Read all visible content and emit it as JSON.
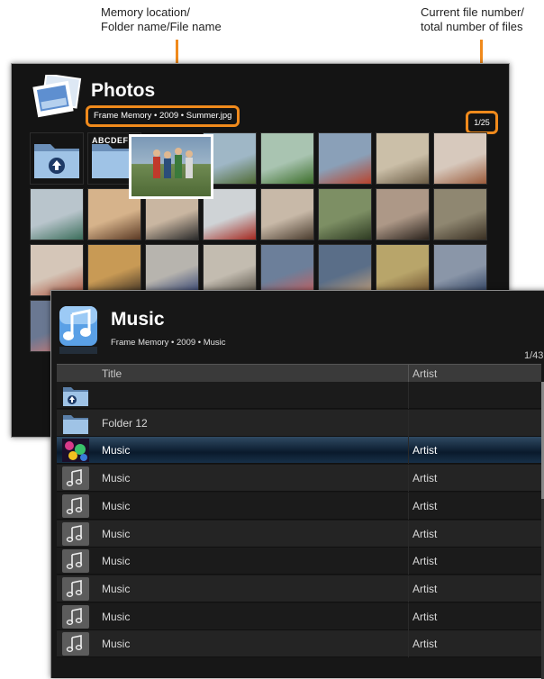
{
  "callouts": {
    "location": {
      "line1": "Memory location/",
      "line2": "Folder name/File name"
    },
    "count": {
      "line1": "Current file number/",
      "line2": "total number of files"
    }
  },
  "photos": {
    "title": "Photos",
    "path": "Frame Memory • 2009 • Summer.jpg",
    "count": "1/25",
    "folder_label": "ABCDEF",
    "thumbs": [
      {
        "color": "#9fb7c6",
        "accent": "#4f6a33"
      },
      {
        "color": "#a9c4b1",
        "accent": "#3c6e2a"
      },
      {
        "color": "#8aa0b8",
        "accent": "#b8432c"
      },
      {
        "color": "#cbbfa8",
        "accent": "#6a5b44"
      },
      {
        "color": "#d7c9bd",
        "accent": "#9b5b3b"
      },
      {
        "color": "#b9c5cc",
        "accent": "#3b6e5b"
      },
      {
        "color": "#d6b38b",
        "accent": "#5b3a25"
      },
      {
        "color": "#c9b6a1",
        "accent": "#2a2a2a"
      },
      {
        "color": "#cfd3d6",
        "accent": "#a4281f"
      },
      {
        "color": "#c8b9a8",
        "accent": "#4a3c2e"
      },
      {
        "color": "#7d8f64",
        "accent": "#2e3b22"
      },
      {
        "color": "#ad9887",
        "accent": "#2a221c"
      },
      {
        "color": "#8f8771",
        "accent": "#3a3023"
      },
      {
        "color": "#d5c6b8",
        "accent": "#a94f3a"
      },
      {
        "color": "#c89a55",
        "accent": "#3a2e22"
      },
      {
        "color": "#b7b4ae",
        "accent": "#2b3c6e"
      },
      {
        "color": "#c3bcb0",
        "accent": "#504a40"
      },
      {
        "color": "#6c7f9a",
        "accent": "#c75e5e"
      },
      {
        "color": "#5a6e88",
        "accent": "#c4a07a"
      },
      {
        "color": "#b8a56a",
        "accent": "#6a4b2a"
      },
      {
        "color": "#8a96a8",
        "accent": "#283a5b"
      },
      {
        "color": "#6a7892",
        "accent": "#d77a72"
      }
    ]
  },
  "music": {
    "title": "Music",
    "path": "Frame Memory • 2009 • Music",
    "count": "1/43",
    "col_title": "Title",
    "col_artist": "Artist",
    "rows": [
      {
        "type": "up-folder",
        "title": "",
        "artist": ""
      },
      {
        "type": "folder",
        "title": "Folder 12",
        "artist": ""
      },
      {
        "type": "album",
        "title": "Music",
        "artist": "Artist",
        "selected": true
      },
      {
        "type": "note",
        "title": "Music",
        "artist": "Artist"
      },
      {
        "type": "note",
        "title": "Music",
        "artist": "Artist"
      },
      {
        "type": "note",
        "title": "Music",
        "artist": "Artist"
      },
      {
        "type": "note",
        "title": "Music",
        "artist": "Artist"
      },
      {
        "type": "note",
        "title": "Music",
        "artist": "Artist"
      },
      {
        "type": "note",
        "title": "Music",
        "artist": "Artist"
      },
      {
        "type": "note",
        "title": "Music",
        "artist": "Artist"
      }
    ]
  },
  "colors": {
    "callout_orange": "#f08a1c",
    "selection_blue": "#173048"
  }
}
